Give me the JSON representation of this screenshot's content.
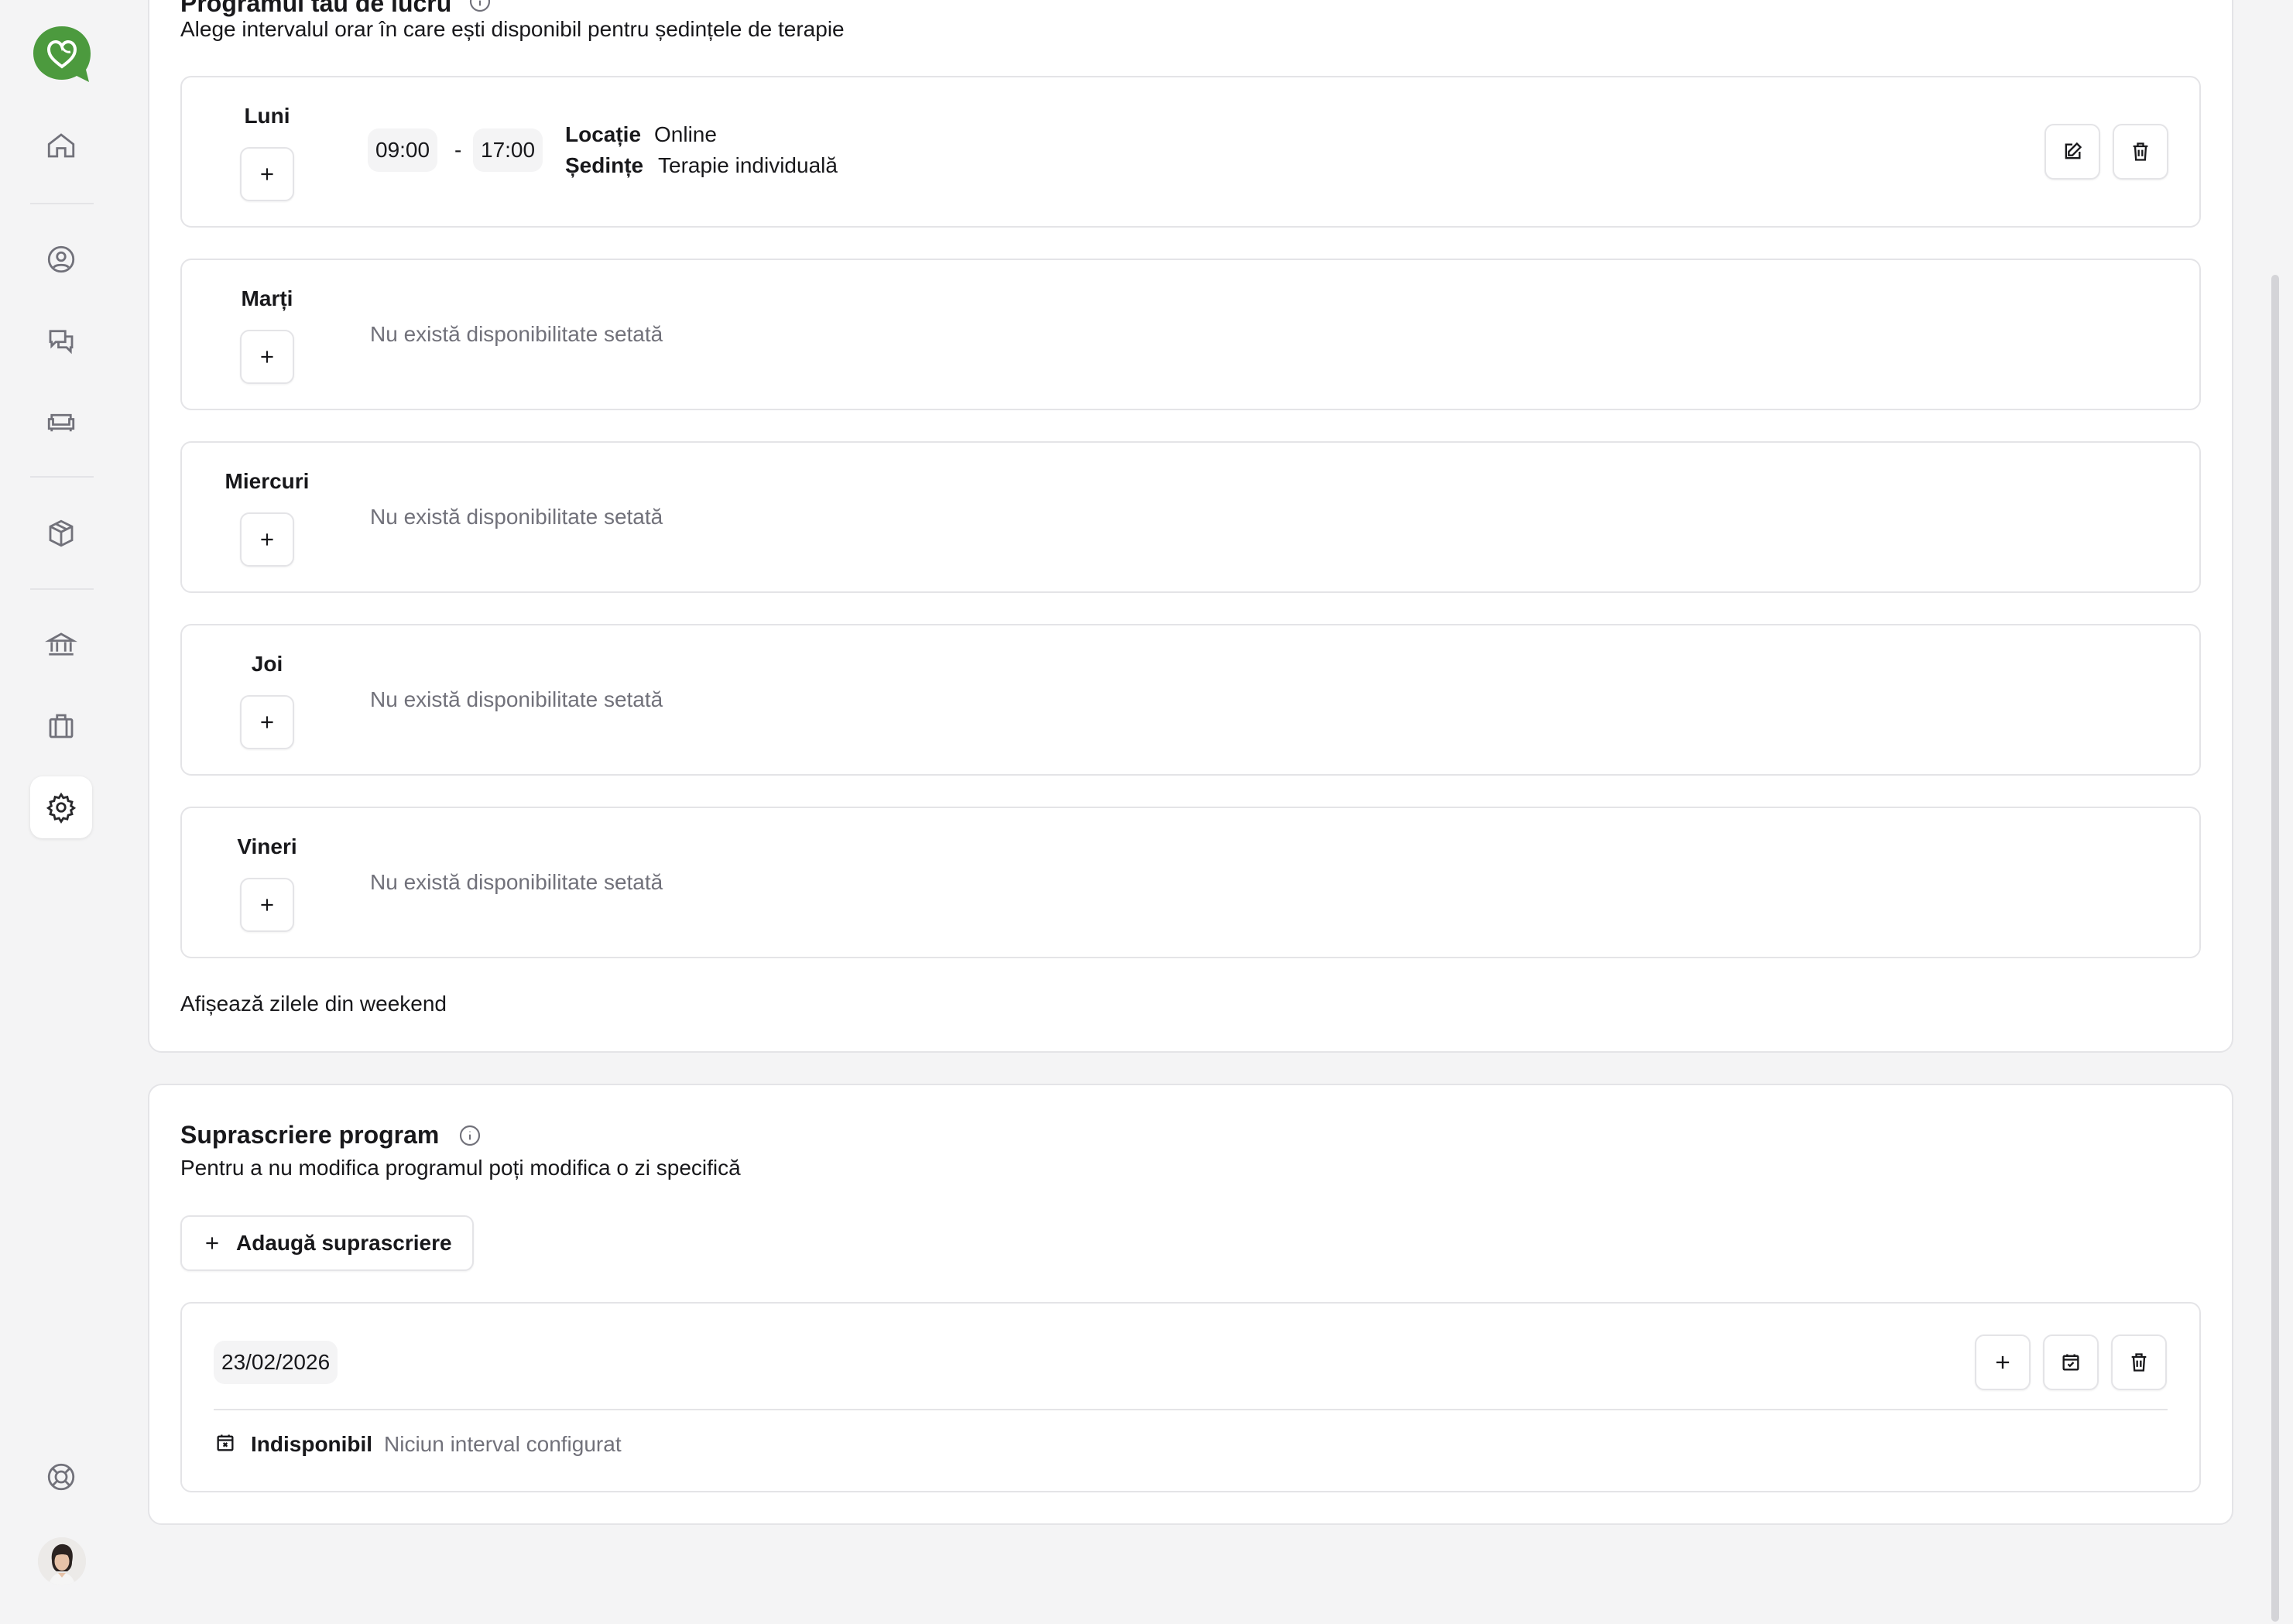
{
  "sidebar": {
    "logo": "chat-heart-logo",
    "items": [
      {
        "icon": "home-icon"
      },
      {
        "icon": "user-circle-icon"
      },
      {
        "icon": "chat-icon"
      },
      {
        "icon": "sofa-icon"
      },
      {
        "icon": "box-icon"
      },
      {
        "icon": "bank-icon"
      },
      {
        "icon": "briefcase-icon"
      },
      {
        "icon": "gear-icon",
        "active": true
      }
    ],
    "bottom": [
      {
        "icon": "lifebuoy-icon"
      },
      {
        "icon": "avatar"
      }
    ]
  },
  "schedule": {
    "title": "Programul tău de lucru",
    "description": "Alege intervalul orar în care ești disponibil pentru ședințele de terapie",
    "days": [
      {
        "name": "Luni",
        "start": "09:00",
        "separator": "-",
        "end": "17:00",
        "location_label": "Locație",
        "location_value": "Online",
        "sessions_label": "Ședințe",
        "sessions_value": "Terapie individuală"
      },
      {
        "name": "Marți",
        "empty": "Nu există disponibilitate setată"
      },
      {
        "name": "Miercuri",
        "empty": "Nu există disponibilitate setată"
      },
      {
        "name": "Joi",
        "empty": "Nu există disponibilitate setată"
      },
      {
        "name": "Vineri",
        "empty": "Nu există disponibilitate setată"
      }
    ],
    "weekend_toggle_label": "Afișează zilele din weekend"
  },
  "override": {
    "title": "Suprascriere program",
    "description": "Pentru a nu modifica programul poți modifica o zi specifică",
    "add_button": "Adaugă suprascriere",
    "entries": [
      {
        "date": "23/02/2026",
        "status_label": "Indisponibil",
        "status_detail": "Niciun interval configurat"
      }
    ]
  },
  "colors": {
    "brand": "#4c9a3e",
    "muted_text": "#71717a",
    "border": "#e4e4e7"
  }
}
